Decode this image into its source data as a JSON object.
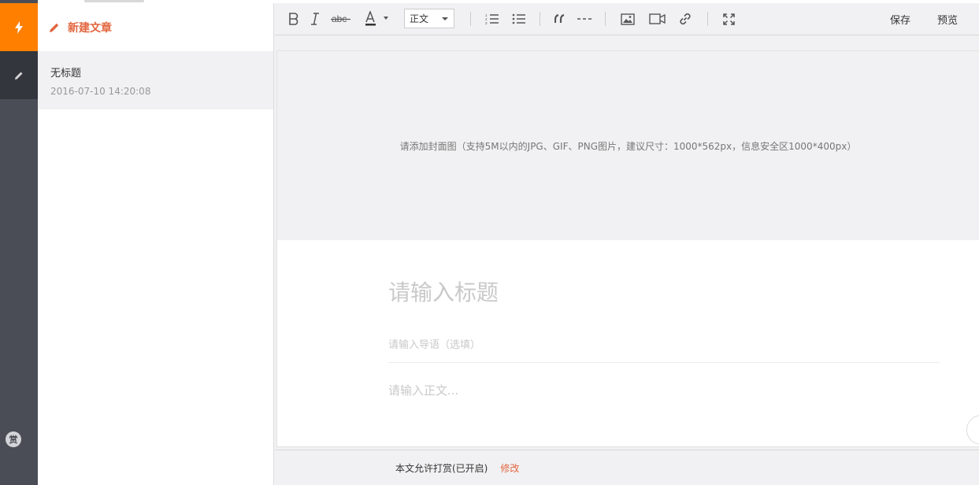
{
  "sidebar": {
    "icons": {
      "quick": "lightning-icon",
      "edit": "pencil-icon",
      "reward": "赏"
    }
  },
  "article_list": {
    "new_article_label": "新建文章",
    "items": [
      {
        "title": "无标题",
        "date": "2016-07-10 14:20:08"
      }
    ]
  },
  "toolbar": {
    "format_select": "正文",
    "save_label": "保存",
    "preview_label": "预览"
  },
  "editor": {
    "cover_hint": "请添加封面图（支持5M以内的JPG、GIF、PNG图片，建议尺寸：1000*562px，信息安全区1000*400px）",
    "title_placeholder": "请输入标题",
    "summary_placeholder": "请输入导语（选填）",
    "body_placeholder": "请输入正文..."
  },
  "footer": {
    "reward_status": "本文允许打赏(已开启)",
    "modify_label": "修改"
  },
  "colors": {
    "accent": "#ff7f00",
    "link": "#e2663f",
    "rail": "#4a4d55"
  }
}
